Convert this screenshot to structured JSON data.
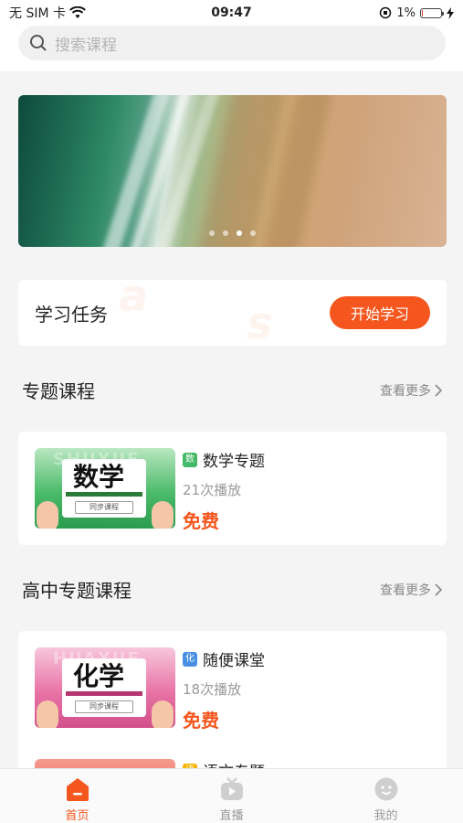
{
  "status_bar": {
    "carrier": "无 SIM 卡",
    "time": "09:47",
    "battery_pct": "1%",
    "battery_level": 0.01
  },
  "search": {
    "placeholder": "搜索课程"
  },
  "banner": {
    "dot_count": 4,
    "active_index": 2
  },
  "task": {
    "title": "学习任务",
    "button": "开始学习"
  },
  "sections": [
    {
      "title": "专题课程",
      "more": "查看更多",
      "courses": [
        {
          "thumb_word": "数学",
          "tag": "数",
          "tag_color": "#43b866",
          "name": "数学专题",
          "plays": "21次播放",
          "price": "免费"
        }
      ]
    },
    {
      "title": "高中专题课程",
      "more": "查看更多",
      "courses": [
        {
          "thumb_word": "化学",
          "tag": "化",
          "tag_color": "#4a90e2",
          "name": "随便课堂",
          "plays": "18次播放",
          "price": "免费"
        },
        {
          "thumb_word": "",
          "tag": "语",
          "tag_color": "#f5b400",
          "name": "语文专题",
          "plays": "",
          "price": ""
        }
      ]
    }
  ],
  "thumb_caption": "同步课程",
  "tabbar": [
    {
      "label": "首页",
      "icon": "home-icon",
      "active": true
    },
    {
      "label": "直播",
      "icon": "live-icon",
      "active": false
    },
    {
      "label": "我的",
      "icon": "profile-icon",
      "active": false
    }
  ],
  "colors": {
    "accent": "#f4561e"
  }
}
